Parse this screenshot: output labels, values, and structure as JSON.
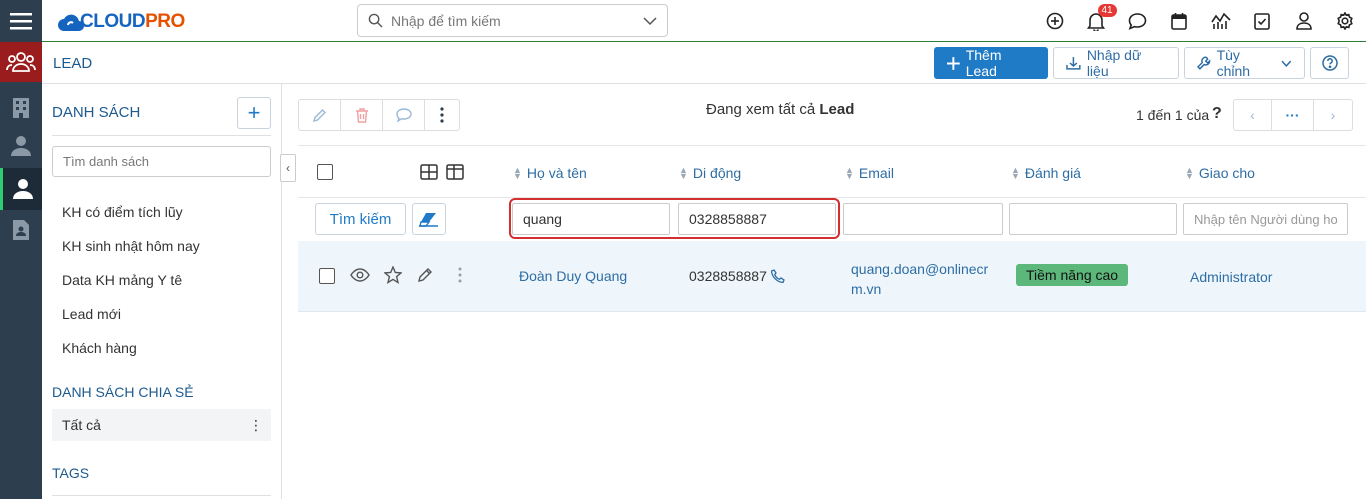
{
  "header": {
    "logo_text_a": "CLOUD",
    "logo_text_b": "PRO",
    "search_placeholder": "Nhập để tìm kiếm",
    "notification_count": "41"
  },
  "titlebar": {
    "title": "LEAD",
    "add_label": "Thêm Lead",
    "import_label": "Nhập dữ liệu",
    "customize_label": "Tùy chỉnh"
  },
  "sidebar": {
    "heading": "DANH SÁCH",
    "search_placeholder": "Tìm danh sách",
    "items": [
      {
        "label": "KH có điểm tích lũy"
      },
      {
        "label": "KH sinh nhật hôm nay"
      },
      {
        "label": "Data KH mảng Y tê"
      },
      {
        "label": "Lead mới"
      },
      {
        "label": "Khách hàng"
      }
    ],
    "shared_heading": "DANH SÁCH CHIA SẺ",
    "shared_item": "Tất cả",
    "tags_heading": "TAGS"
  },
  "main": {
    "viewing_prefix": "Đang xem tất cả",
    "viewing_entity": "Lead",
    "pager_text": "1 đến 1 của",
    "pager_more": "···"
  },
  "table": {
    "columns": [
      "Họ và tên",
      "Di động",
      "Email",
      "Đánh giá",
      "Giao cho"
    ],
    "search_button": "Tìm kiếm",
    "filters": {
      "name": "quang",
      "mobile": "0328858887",
      "email": "",
      "rating": "",
      "assignee_placeholder": "Nhập tên Người dùng hoặc"
    },
    "rows": [
      {
        "name": "Đoàn Duy Quang",
        "mobile": "0328858887",
        "email_line1": "quang.doan@onlinecr",
        "email_line2": "m.vn",
        "rating": "Tiềm năng cao",
        "assignee": "Administrator"
      }
    ]
  },
  "colors": {
    "rail": "#2d3e4f",
    "rail_active": "#9b1c1c",
    "primary": "#1f7bc6",
    "rating_pill": "#5cb87a",
    "highlight": "#d32f2f"
  }
}
